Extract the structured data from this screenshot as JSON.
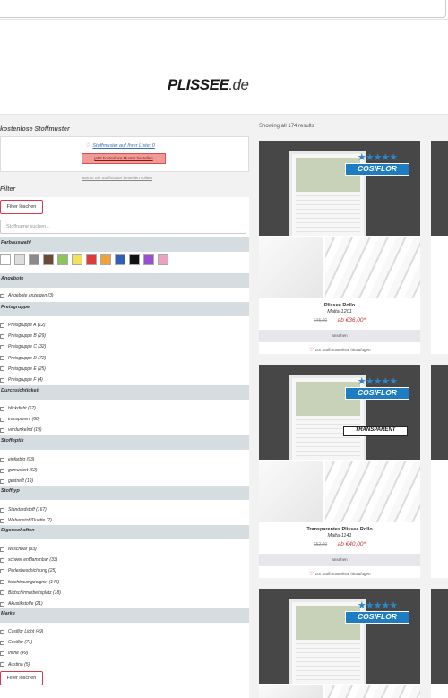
{
  "header": {
    "logo_main": "PLISSEE",
    "logo_tld": ".de"
  },
  "sidebar": {
    "samples_title": "kostenlose Stoffmuster",
    "samples_link": "Stoffmuster auf Ihrer Liste: 0",
    "samples_button": "jetzt kostenlose Muster bestellen",
    "samples_note": "warum Sie Stoffmuster bestellen sollten",
    "filter_title": "Filter",
    "filter_reset": "Filter löschen",
    "search_placeholder": "Stoffname suchen...",
    "sections": {
      "colors": "Farbauswahl",
      "offers": "Angebote",
      "price": "Preisgruppe",
      "opacity": "Durchsichtigkeit",
      "look": "Stoffoptik",
      "type": "Stofftyp",
      "properties": "Eigenschaften",
      "brand": "Marke"
    },
    "colors": [
      "#ffffff",
      "#dddddd",
      "#8a8a8a",
      "#6b4a34",
      "#8ac45a",
      "#f2e15a",
      "#e03a3a",
      "#f0a23a",
      "#2f5fb5",
      "#111111",
      "#9a4fd0",
      "#eca1bd"
    ],
    "offers": [
      "Angebote anzeigen (3)"
    ],
    "price_groups": [
      "Preisgruppe A (12)",
      "Preisgruppe B (29)",
      "Preisgruppe C (32)",
      "Preisgruppe D (72)",
      "Preisgruppe E (25)",
      "Preisgruppe F (4)"
    ],
    "opacity": [
      "blickdicht (67)",
      "transparent (68)",
      "verdunkelnd (19)"
    ],
    "look": [
      "einfarbig (93)",
      "gemustert (62)",
      "gestreift (19)"
    ],
    "type": [
      "Standardstoff (167)",
      "Wabenstoff/Duette (7)"
    ],
    "properties": [
      "waschbar (93)",
      "schwer entflammbar (33)",
      "Perlexbeschichtung (25)",
      "feuchtraumgeeignet (145)",
      "Bildschirmarbeitsplatz (18)",
      "Akustikstoffe (21)"
    ],
    "brand": [
      "Cosiflor Light (49)",
      "Cosiflor (71)",
      "Inline (49)",
      "Austina (5)"
    ]
  },
  "results": {
    "count": "Showing all 174 results",
    "badge_brand": "COSIFLOR",
    "stars": "★★★★★",
    "transparent_badge": "TRANSPARENT",
    "show_label": "ansehen",
    "fav_label": "zur Stoffmusterliste hinzufügen",
    "cards": [
      {
        "name": "Plissee Rollo",
        "sub": "Malta-1201",
        "price_old": "€45,00",
        "price_new": "ab €36,00*"
      },
      {
        "name": "Transparentes Plissee Rollo",
        "sub": "Malta-1141",
        "price_old": "€52,00",
        "price_new": "ab €40,00*"
      }
    ]
  }
}
